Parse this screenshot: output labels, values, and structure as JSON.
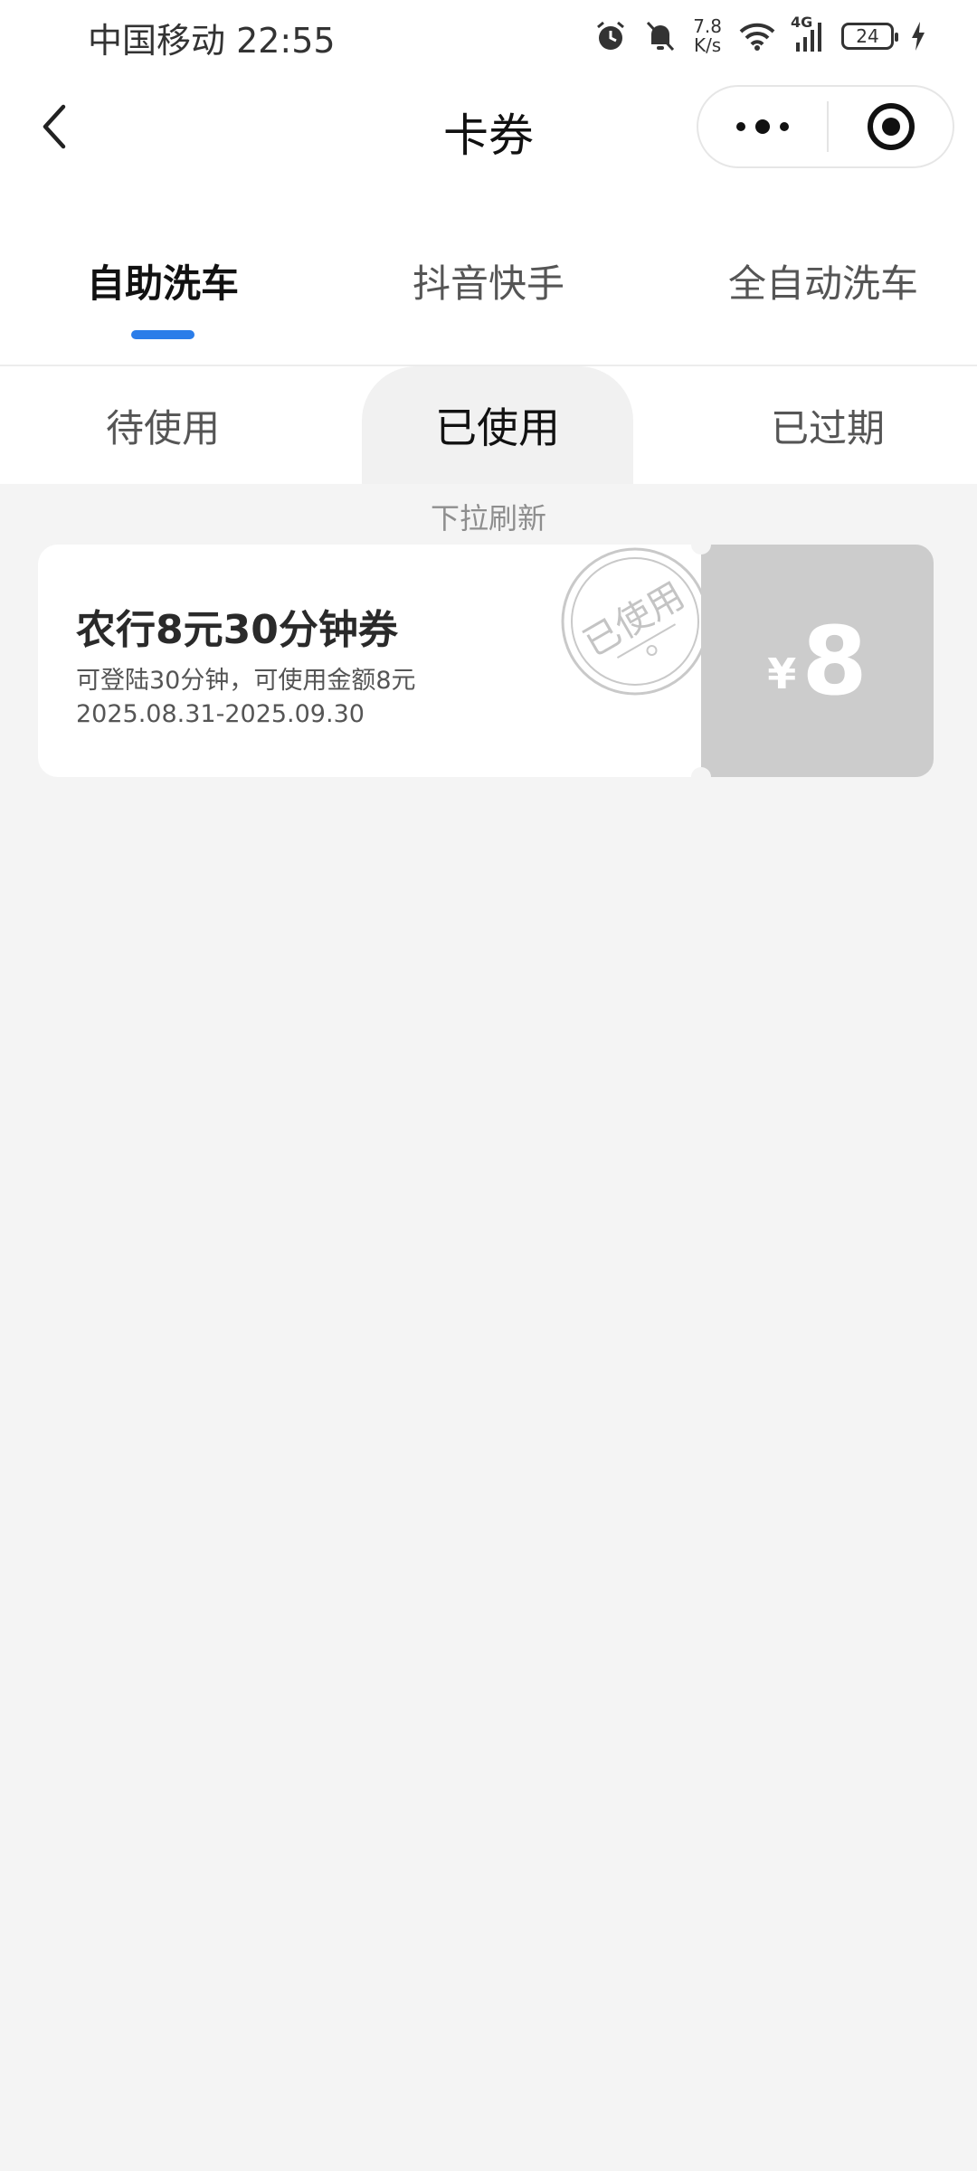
{
  "status_bar": {
    "carrier_time": "中国移动 22:55",
    "net_speed_value": "7.8",
    "net_speed_unit": "K/s",
    "network_type": "4G",
    "battery_level": "24",
    "icons": [
      "alarm-icon",
      "mute-bell-icon",
      "wifi-icon",
      "signal-icon",
      "battery-icon",
      "charging-icon"
    ]
  },
  "nav": {
    "title": "卡券",
    "icons": [
      "back-arrow-icon",
      "more-dots-icon",
      "close-target-icon"
    ]
  },
  "category_tabs": [
    {
      "label": "自助洗车",
      "active": true
    },
    {
      "label": "抖音快手",
      "active": false
    },
    {
      "label": "全自动洗车",
      "active": false
    }
  ],
  "status_tabs": [
    {
      "label": "待使用",
      "active": false
    },
    {
      "label": "已使用",
      "active": true
    },
    {
      "label": "已过期",
      "active": false
    }
  ],
  "pull_hint": "下拉刷新",
  "coupons": [
    {
      "title": "农行8元30分钟券",
      "description": "可登陆30分钟，可使用金额8元",
      "validity": "2025.08.31-2025.09.30",
      "stamp": "已使用",
      "currency": "¥",
      "amount": "8"
    }
  ],
  "colors": {
    "accent": "#2b7de9",
    "coupon_price_bg": "#cccccc",
    "page_bg": "#f4f4f4"
  }
}
